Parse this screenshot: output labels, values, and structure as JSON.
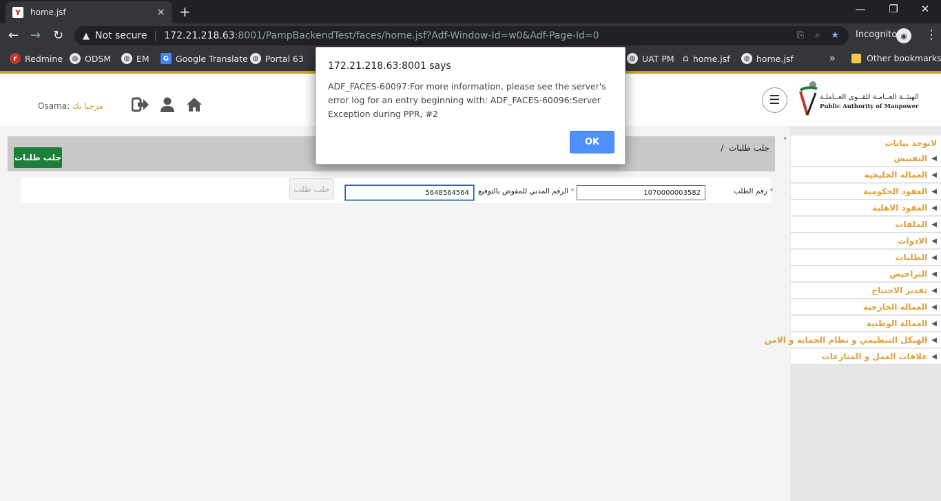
{
  "browser": {
    "tab_title": "home.jsf",
    "tab_favicon": "app-favicon",
    "new_tab_symbol": "+",
    "security_label": "Not secure",
    "url_host": "172.21.218.63",
    "url_path": ":8001/PampBackendTest/faces/home.jsf?Adf-Window-Id=w0&Adf-Page-Id=0",
    "incognito_label": "Incognito",
    "bookmarks": [
      "Redmine",
      "ODSM",
      "EM",
      "Google Translate",
      "Portal 63",
      "UAT PM",
      "home.jsf",
      "home.jsf"
    ],
    "bookmarks_overflow": "»",
    "other_bookmarks": "Other bookmarks"
  },
  "header": {
    "welcome_ar": "مرحبا بك",
    "welcome_user": "Osama",
    "logo_ar": "الهيئــة العــامـة للقــوى العــاملـة",
    "logo_en": "Public Authority of Manpower"
  },
  "breadcrumb": {
    "text": "جلب طلبات",
    "separator": "/"
  },
  "actions": {
    "fetch_requests_button": "جلب طلبات",
    "fetch_request_button": "جلب طلب"
  },
  "form": {
    "request_no_label": "رقم الطلب",
    "request_no_value": "1070000003582",
    "civil_id_label": "الرقم المدني للمفوض بالتوقيع",
    "civil_id_value": "5648564564",
    "required_mark": "*"
  },
  "sidebar": {
    "top_label": "لاتوجد بيانات",
    "items": [
      "التفتيش",
      "العمالة الخليجية",
      "العقود الحكومية",
      "العقود الاهلية",
      "الملفات",
      "الادوات",
      "الطلبات",
      "التراخيص",
      "تقدير الاحتياج",
      "العمالة الخارجية",
      "العمالة الوطنية",
      "الهيكل التنظيمي و نظام الحماية و الامن",
      "علاقات العمل و المنازعات"
    ]
  },
  "dialog": {
    "title": "172.21.218.63:8001 says",
    "message": "ADF_FACES-60097:For more information, please see the server's error log for an entry beginning with: ADF_FACES-60096:Server Exception during PPR, #2",
    "ok_label": "OK"
  }
}
